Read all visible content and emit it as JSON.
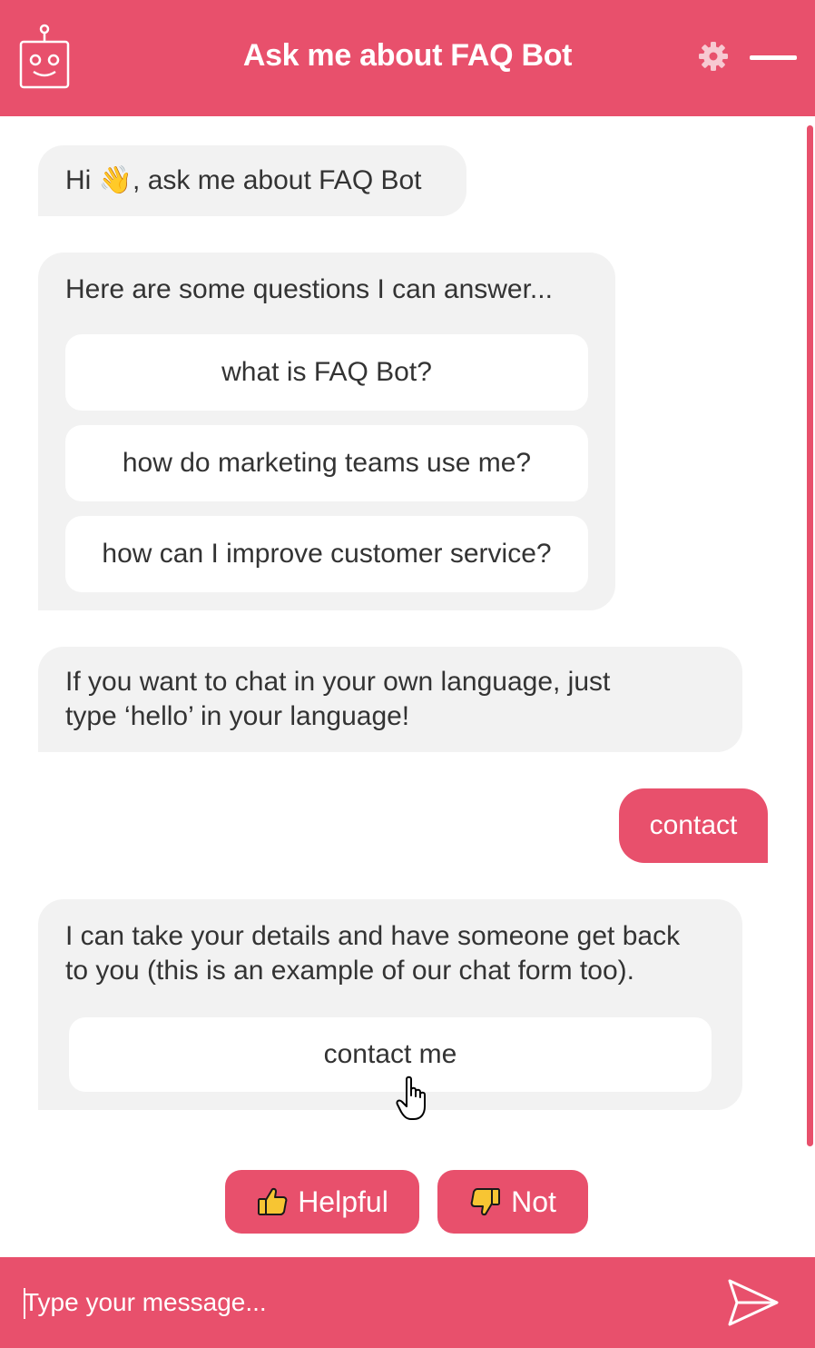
{
  "header": {
    "title": "Ask me about FAQ Bot",
    "avatar_icon": "robot-icon",
    "settings_icon": "gear-icon",
    "minimize_icon": "minimize-icon"
  },
  "colors": {
    "accent": "#e8506c",
    "bot_bubble": "#f2f2f2",
    "text": "#333333"
  },
  "messages": {
    "greeting": {
      "text_pre": "Hi ",
      "emoji": "👋",
      "text_post": ", ask me about FAQ Bot"
    },
    "questions_intro": "Here are some questions I can answer...",
    "questions": [
      "what is FAQ Bot?",
      "how do marketing teams use me?",
      "how can I improve customer service?"
    ],
    "language_note_line1": "If you want to chat in your own language, just",
    "language_note_line2": "type ‘hello’ in your language!",
    "user_message": "contact",
    "contact_reply_line1": "I can take your details and have someone get back",
    "contact_reply_line2": "to you (this is an example of our chat form too).",
    "contact_button": "contact me"
  },
  "feedback": {
    "helpful_label": "Helpful",
    "helpful_icon": "thumbs-up-icon",
    "not_label": "Not",
    "not_icon": "thumbs-down-icon"
  },
  "composer": {
    "placeholder": "Type your message...",
    "value": "",
    "send_icon": "send-icon"
  }
}
